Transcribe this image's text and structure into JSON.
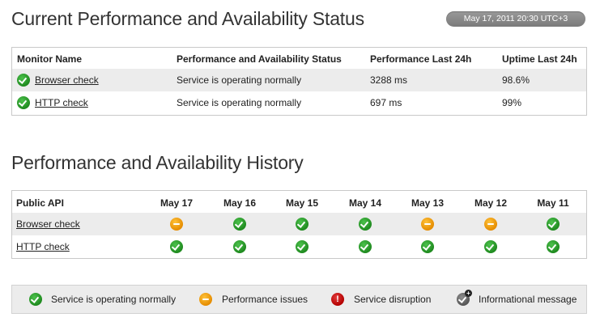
{
  "current": {
    "title": "Current Performance and Availability Status",
    "timestamp": "May 17, 2011 20:30 UTC+3",
    "headers": {
      "monitor": "Monitor Name",
      "status": "Performance and Availability Status",
      "perf": "Performance Last 24h",
      "uptime": "Uptime Last 24h"
    },
    "rows": [
      {
        "name": "Browser check",
        "status": "Service is operating normally",
        "perf": "3288 ms",
        "uptime": "98.6%"
      },
      {
        "name": "HTTP check",
        "status": "Service is operating normally",
        "perf": "697 ms",
        "uptime": "99%"
      }
    ]
  },
  "history": {
    "title": "Performance and Availability History",
    "first_header": "Public API",
    "dates": [
      "May 17",
      "May 16",
      "May 15",
      "May 14",
      "May 13",
      "May 12",
      "May 11"
    ],
    "rows": [
      {
        "name": "Browser check",
        "states": [
          "warn",
          "ok",
          "ok",
          "ok",
          "warn",
          "warn",
          "ok"
        ]
      },
      {
        "name": "HTTP check",
        "states": [
          "ok",
          "ok",
          "ok",
          "ok",
          "ok",
          "ok",
          "ok"
        ]
      }
    ]
  },
  "legend": {
    "ok": "Service is operating normally",
    "warn": "Performance issues",
    "err": "Service disruption",
    "info": "Informational message"
  }
}
